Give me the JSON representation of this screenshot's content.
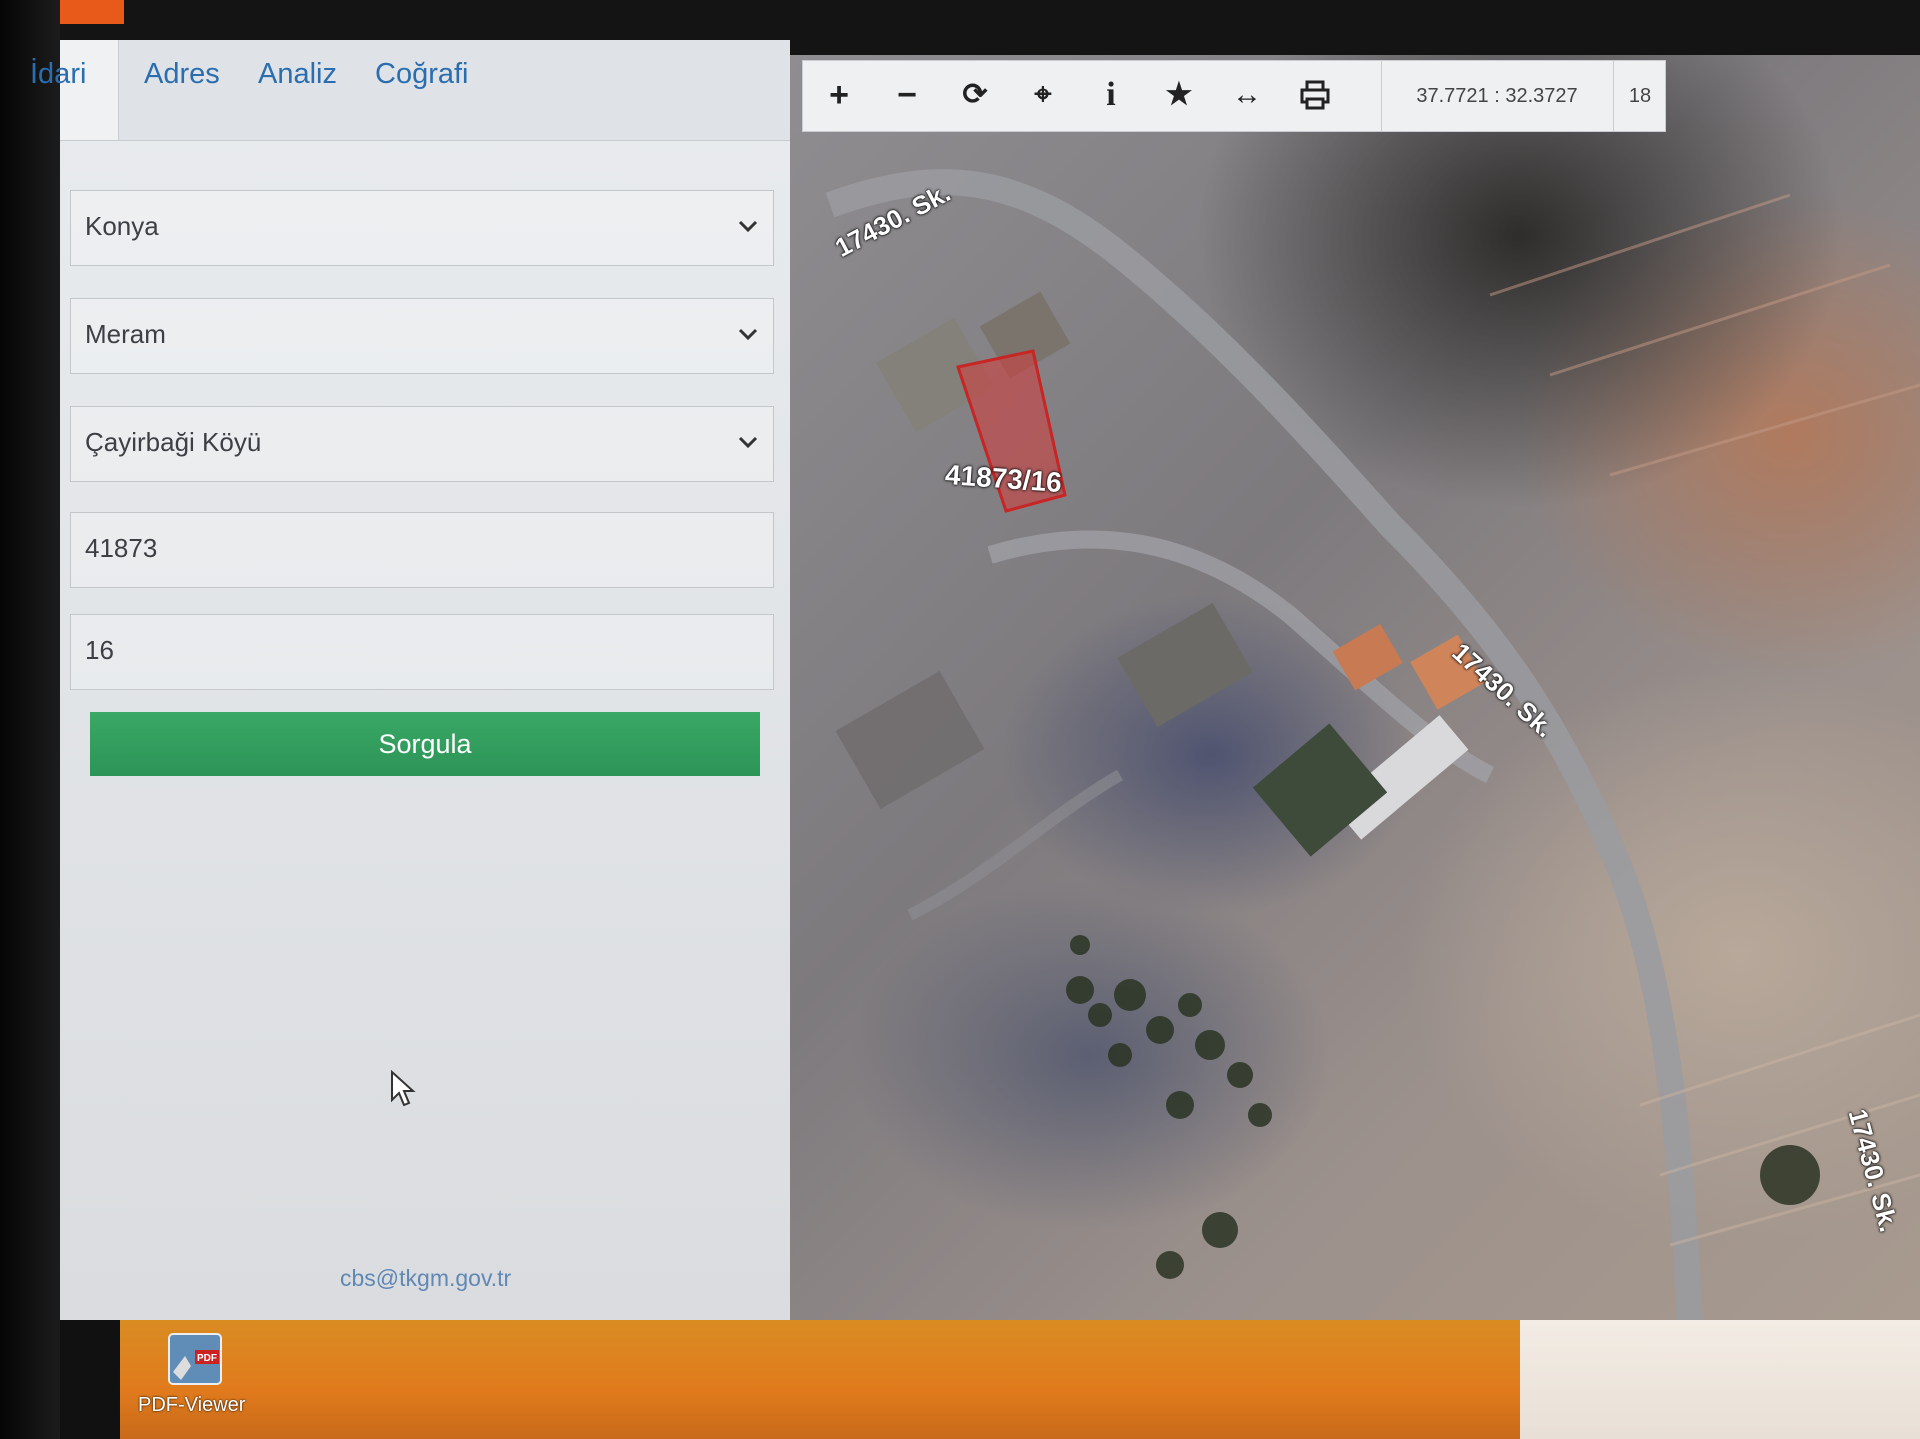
{
  "tabs": [
    "İdari",
    "Adres",
    "Analiz",
    "Coğrafi"
  ],
  "query": {
    "il": "Konya",
    "ilce": "Meram",
    "mahalle": "Çayirbaği Köyü",
    "ada": "41873",
    "parsel": "16",
    "submit_label": "Sorgula"
  },
  "footer_email": "cbs@tkgm.gov.tr",
  "toolbar": {
    "tools": [
      "zoom-in-icon",
      "zoom-out-icon",
      "refresh-icon",
      "locate-icon",
      "info-icon",
      "favorite-icon",
      "measure-icon",
      "print-icon"
    ],
    "coordinates": "37.7721 : 32.3727",
    "zoom_level": "18"
  },
  "map": {
    "street_labels": [
      "17430. Sk.",
      "17430. Sk.",
      "17430. Sk."
    ],
    "parcel_label": "41873/16",
    "parcel_color": "#d43b3b"
  },
  "taskbar": {
    "icon_label": "PDF-Viewer"
  }
}
